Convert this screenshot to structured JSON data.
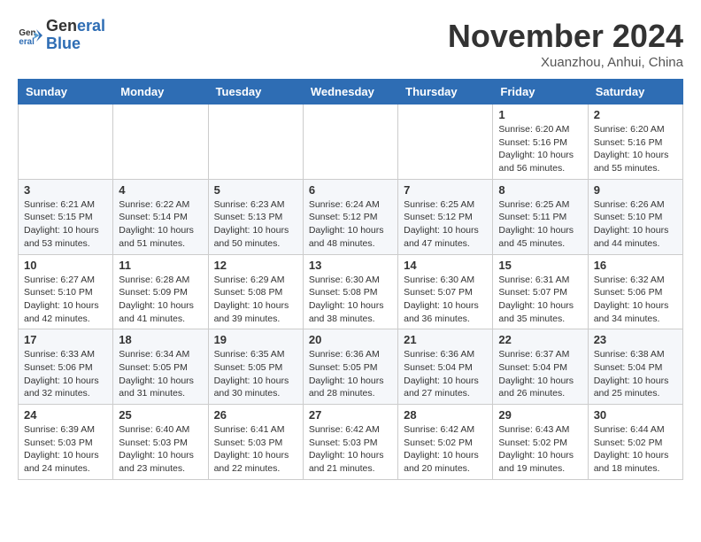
{
  "header": {
    "logo_line1": "General",
    "logo_line2": "Blue",
    "month": "November 2024",
    "location": "Xuanzhou, Anhui, China"
  },
  "weekdays": [
    "Sunday",
    "Monday",
    "Tuesday",
    "Wednesday",
    "Thursday",
    "Friday",
    "Saturday"
  ],
  "weeks": [
    [
      {
        "day": "",
        "info": ""
      },
      {
        "day": "",
        "info": ""
      },
      {
        "day": "",
        "info": ""
      },
      {
        "day": "",
        "info": ""
      },
      {
        "day": "",
        "info": ""
      },
      {
        "day": "1",
        "info": "Sunrise: 6:20 AM\nSunset: 5:16 PM\nDaylight: 10 hours\nand 56 minutes."
      },
      {
        "day": "2",
        "info": "Sunrise: 6:20 AM\nSunset: 5:16 PM\nDaylight: 10 hours\nand 55 minutes."
      }
    ],
    [
      {
        "day": "3",
        "info": "Sunrise: 6:21 AM\nSunset: 5:15 PM\nDaylight: 10 hours\nand 53 minutes."
      },
      {
        "day": "4",
        "info": "Sunrise: 6:22 AM\nSunset: 5:14 PM\nDaylight: 10 hours\nand 51 minutes."
      },
      {
        "day": "5",
        "info": "Sunrise: 6:23 AM\nSunset: 5:13 PM\nDaylight: 10 hours\nand 50 minutes."
      },
      {
        "day": "6",
        "info": "Sunrise: 6:24 AM\nSunset: 5:12 PM\nDaylight: 10 hours\nand 48 minutes."
      },
      {
        "day": "7",
        "info": "Sunrise: 6:25 AM\nSunset: 5:12 PM\nDaylight: 10 hours\nand 47 minutes."
      },
      {
        "day": "8",
        "info": "Sunrise: 6:25 AM\nSunset: 5:11 PM\nDaylight: 10 hours\nand 45 minutes."
      },
      {
        "day": "9",
        "info": "Sunrise: 6:26 AM\nSunset: 5:10 PM\nDaylight: 10 hours\nand 44 minutes."
      }
    ],
    [
      {
        "day": "10",
        "info": "Sunrise: 6:27 AM\nSunset: 5:10 PM\nDaylight: 10 hours\nand 42 minutes."
      },
      {
        "day": "11",
        "info": "Sunrise: 6:28 AM\nSunset: 5:09 PM\nDaylight: 10 hours\nand 41 minutes."
      },
      {
        "day": "12",
        "info": "Sunrise: 6:29 AM\nSunset: 5:08 PM\nDaylight: 10 hours\nand 39 minutes."
      },
      {
        "day": "13",
        "info": "Sunrise: 6:30 AM\nSunset: 5:08 PM\nDaylight: 10 hours\nand 38 minutes."
      },
      {
        "day": "14",
        "info": "Sunrise: 6:30 AM\nSunset: 5:07 PM\nDaylight: 10 hours\nand 36 minutes."
      },
      {
        "day": "15",
        "info": "Sunrise: 6:31 AM\nSunset: 5:07 PM\nDaylight: 10 hours\nand 35 minutes."
      },
      {
        "day": "16",
        "info": "Sunrise: 6:32 AM\nSunset: 5:06 PM\nDaylight: 10 hours\nand 34 minutes."
      }
    ],
    [
      {
        "day": "17",
        "info": "Sunrise: 6:33 AM\nSunset: 5:06 PM\nDaylight: 10 hours\nand 32 minutes."
      },
      {
        "day": "18",
        "info": "Sunrise: 6:34 AM\nSunset: 5:05 PM\nDaylight: 10 hours\nand 31 minutes."
      },
      {
        "day": "19",
        "info": "Sunrise: 6:35 AM\nSunset: 5:05 PM\nDaylight: 10 hours\nand 30 minutes."
      },
      {
        "day": "20",
        "info": "Sunrise: 6:36 AM\nSunset: 5:05 PM\nDaylight: 10 hours\nand 28 minutes."
      },
      {
        "day": "21",
        "info": "Sunrise: 6:36 AM\nSunset: 5:04 PM\nDaylight: 10 hours\nand 27 minutes."
      },
      {
        "day": "22",
        "info": "Sunrise: 6:37 AM\nSunset: 5:04 PM\nDaylight: 10 hours\nand 26 minutes."
      },
      {
        "day": "23",
        "info": "Sunrise: 6:38 AM\nSunset: 5:04 PM\nDaylight: 10 hours\nand 25 minutes."
      }
    ],
    [
      {
        "day": "24",
        "info": "Sunrise: 6:39 AM\nSunset: 5:03 PM\nDaylight: 10 hours\nand 24 minutes."
      },
      {
        "day": "25",
        "info": "Sunrise: 6:40 AM\nSunset: 5:03 PM\nDaylight: 10 hours\nand 23 minutes."
      },
      {
        "day": "26",
        "info": "Sunrise: 6:41 AM\nSunset: 5:03 PM\nDaylight: 10 hours\nand 22 minutes."
      },
      {
        "day": "27",
        "info": "Sunrise: 6:42 AM\nSunset: 5:03 PM\nDaylight: 10 hours\nand 21 minutes."
      },
      {
        "day": "28",
        "info": "Sunrise: 6:42 AM\nSunset: 5:02 PM\nDaylight: 10 hours\nand 20 minutes."
      },
      {
        "day": "29",
        "info": "Sunrise: 6:43 AM\nSunset: 5:02 PM\nDaylight: 10 hours\nand 19 minutes."
      },
      {
        "day": "30",
        "info": "Sunrise: 6:44 AM\nSunset: 5:02 PM\nDaylight: 10 hours\nand 18 minutes."
      }
    ]
  ]
}
